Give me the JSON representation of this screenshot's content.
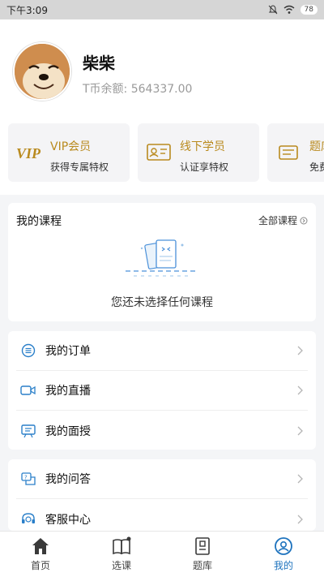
{
  "status_bar": {
    "time": "下午3:09",
    "battery": "78"
  },
  "profile": {
    "name": "柴柴",
    "balance_label": "T币余额: ",
    "balance_value": "564337.00"
  },
  "cards": [
    {
      "icon": "vip-icon",
      "title": "VIP会员",
      "subtitle": "获得专属特权"
    },
    {
      "icon": "id-card-icon",
      "title": "线下学员",
      "subtitle": "认证享特权"
    },
    {
      "icon": "question-bank-icon",
      "title": "题库",
      "subtitle": "免费"
    }
  ],
  "course": {
    "title": "我的课程",
    "all_label": "全部课程",
    "empty_text": "您还未选择任何课程"
  },
  "menu_group_1": [
    {
      "icon": "order-icon",
      "label": "我的订单"
    },
    {
      "icon": "live-video-icon",
      "label": "我的直播"
    },
    {
      "icon": "interview-icon",
      "label": "我的面授"
    }
  ],
  "menu_group_2": [
    {
      "icon": "qa-icon",
      "label": "我的问答"
    },
    {
      "icon": "headset-icon",
      "label": "客服中心"
    }
  ],
  "tabbar": [
    {
      "icon": "home-icon",
      "label": "首页"
    },
    {
      "icon": "book-icon",
      "label": "选课"
    },
    {
      "icon": "question-bank-icon",
      "label": "题库"
    },
    {
      "icon": "profile-icon",
      "label": "我的"
    }
  ],
  "colors": {
    "accent": "#1e73be",
    "gold": "#b98a1e",
    "icon_blue": "#2a7fc9"
  }
}
